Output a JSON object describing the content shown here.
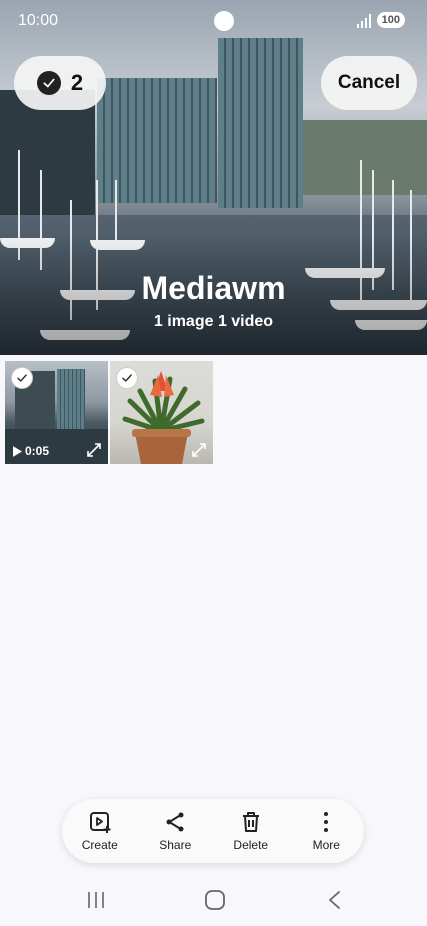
{
  "status": {
    "time": "10:00",
    "battery": "100"
  },
  "selection": {
    "count": "2",
    "cancel_label": "Cancel"
  },
  "album": {
    "title": "Mediawm",
    "subtitle": "1 image 1 video"
  },
  "thumbnails": [
    {
      "kind": "video",
      "duration": "0:05",
      "selected": true
    },
    {
      "kind": "image",
      "selected": true
    }
  ],
  "actions": [
    {
      "label": "Create",
      "icon": "create-icon"
    },
    {
      "label": "Share",
      "icon": "share-icon"
    },
    {
      "label": "Delete",
      "icon": "delete-icon"
    },
    {
      "label": "More",
      "icon": "more-icon"
    }
  ],
  "navigation": [
    "recents-icon",
    "home-icon",
    "back-icon"
  ]
}
